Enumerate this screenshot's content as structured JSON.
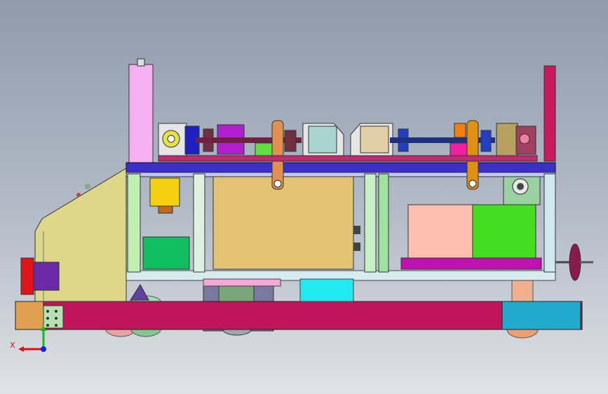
{
  "viewport": {
    "background_top": "#8f9aab",
    "background_bottom": "#dfe2e6"
  },
  "triad": {
    "x_label": "X",
    "x_color": "#e01010",
    "y_color": "#10c010",
    "z_color": "#1020e0"
  },
  "model": {
    "frame_color": "#c0155b",
    "deck_color": "#3b2fc8",
    "cabinet_color": "#ddd78a",
    "gearbox_color": "#e2c373",
    "battery_left_color": "#ffbfb0",
    "battery_right_color": "#44dd22",
    "wheel_housing_color": "#22aacc"
  }
}
